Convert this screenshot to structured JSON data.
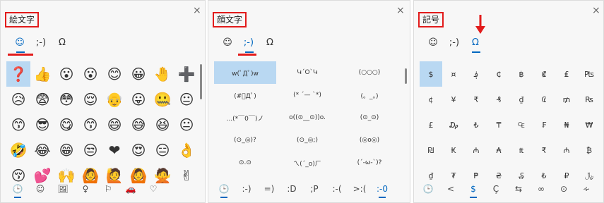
{
  "emoji_panel": {
    "title": "絵文字",
    "close": "×",
    "tabs": [
      "☺",
      ";-)",
      "Ω"
    ],
    "emojis": [
      "❓",
      "👍",
      "😮",
      "😮",
      "😊",
      "😀",
      "🤚",
      "➕",
      "😥",
      "😨",
      "😳",
      "😌",
      "👴",
      "😛",
      "🤐",
      "😐",
      "😙",
      "😎",
      "😋",
      "😙",
      "😄",
      "😅",
      "😆",
      "😐",
      "🤣",
      "😂",
      "😁",
      "😒",
      "❤",
      "😍",
      "😑",
      "👌",
      "😚",
      "💕",
      "🙌",
      "🙆",
      "🙋",
      "🙆",
      "🙅",
      "✌"
    ],
    "bottom_tabs": [
      "🕒",
      "☺",
      "🖼",
      "♀",
      "⚐",
      "🚗",
      "♡"
    ]
  },
  "kaomoji_panel": {
    "title": "顔文字",
    "close": "×",
    "tabs": [
      "☺",
      ";-)",
      "Ω"
    ],
    "items": [
      "w(ﾟДﾟ)w",
      "ԿˊOˋԿ",
      "(○○○)",
      "(#ﾟДﾟ)",
      "(* ˊ— ˋ*)",
      "(。_。)",
      "...(*￣0￣)ノ",
      "o((⊙__⊙))o.",
      "(⊙_⊙)",
      "(⊙_◎)?",
      "(⊙_◎;)",
      "(◎o◎)",
      "⊙.⊙",
      "ㄟ(ˊ_o)ㄏ",
      "(ˊ-ω-ˋ)?"
    ],
    "bottom_tabs": [
      "🕒",
      ":-)",
      "=)",
      ":D",
      ";P",
      ":-(",
      ">:(",
      ":-0"
    ]
  },
  "symbol_panel": {
    "title": "記号",
    "close": "×",
    "tabs": [
      "☺",
      ";-)",
      "Ω"
    ],
    "symbols": [
      "$",
      "¤",
      "؋",
      "₵",
      "฿",
      "₡",
      "₤",
      "₧",
      "¢",
      "¥",
      "₹",
      "₰",
      "₫",
      "₢",
      "₥",
      "₨",
      "£",
      "₯",
      "₺",
      "₸",
      "₠",
      "₣",
      "₦",
      "₩",
      "₪",
      "₭",
      "₼",
      "₳",
      "₶",
      "₹",
      "₼",
      "₿",
      "₫",
      "₮",
      "₱",
      "₴",
      "₷",
      "₺",
      "₽",
      "﷼"
    ],
    "bottom_tabs": [
      "🕒",
      "<",
      "$",
      "Ç",
      "⇆",
      "∞",
      "⊙",
      "∻"
    ]
  }
}
